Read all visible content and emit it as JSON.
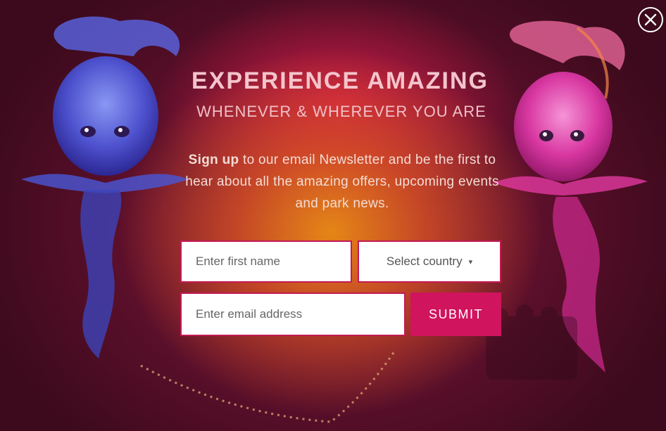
{
  "popup": {
    "headline": "EXPERIENCE AMAZING",
    "subheadline": "WHENEVER & WHEREVER YOU ARE",
    "description_bold": "Sign up",
    "description_rest": " to our email Newsletter and be the first to hear about all the amazing offers, upcoming events and park news.",
    "close_icon": "close-icon"
  },
  "form": {
    "first_name_placeholder": "Enter first name",
    "country_label": "Select country",
    "country_caret": "▾",
    "email_placeholder": "Enter email address",
    "submit_label": "SUBMIT"
  },
  "colors": {
    "accent": "#d0145e",
    "field_border": "#c21a56",
    "headline": "#f4c4cc"
  }
}
